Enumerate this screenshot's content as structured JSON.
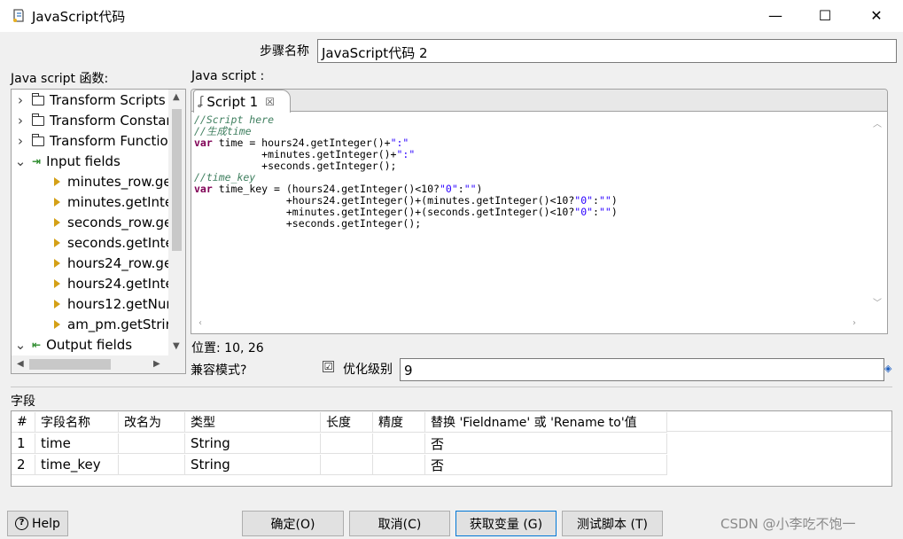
{
  "window": {
    "title": "JavaScript代码",
    "min_glyph": "—",
    "max_glyph": "☐",
    "close_glyph": "✕"
  },
  "step_name": {
    "label": "步骤名称",
    "value": "JavaScript代码 2"
  },
  "functions_panel": {
    "label": "Java script 函数:",
    "items": [
      {
        "label": "Transform Scripts",
        "kind": "folder",
        "expander": "›"
      },
      {
        "label": "Transform Constar",
        "kind": "folder",
        "expander": "›"
      },
      {
        "label": "Transform Functio",
        "kind": "folder",
        "expander": "›"
      },
      {
        "label": "Input fields",
        "kind": "input",
        "expander": "⌄"
      },
      {
        "label": "minutes_row.ge",
        "kind": "field"
      },
      {
        "label": "minutes.getInte",
        "kind": "field"
      },
      {
        "label": "seconds_row.ge",
        "kind": "field"
      },
      {
        "label": "seconds.getInte",
        "kind": "field"
      },
      {
        "label": "hours24_row.ge",
        "kind": "field"
      },
      {
        "label": "hours24.getInte",
        "kind": "field"
      },
      {
        "label": "hours12.getNur",
        "kind": "field"
      },
      {
        "label": "am_pm.getStrir",
        "kind": "field"
      },
      {
        "label": "Output fields",
        "kind": "output",
        "expander": "⌄"
      }
    ]
  },
  "script_panel": {
    "label": "Java script :",
    "tab_label": "Script 1",
    "code_lines": [
      [
        {
          "t": "//Script here",
          "c": "cm"
        }
      ],
      [
        {
          "t": "//生成time",
          "c": "cm"
        }
      ],
      [
        {
          "t": "var",
          "c": "kw"
        },
        {
          "t": " time = hours24.getInteger()+",
          "c": ""
        },
        {
          "t": "\":\"",
          "c": "st"
        }
      ],
      [
        {
          "t": "           +minutes.getInteger()+",
          "c": ""
        },
        {
          "t": "\":\"",
          "c": "st"
        }
      ],
      [
        {
          "t": "           +seconds.getInteger();",
          "c": ""
        }
      ],
      [
        {
          "t": "//time_key",
          "c": "cm"
        }
      ],
      [
        {
          "t": "var",
          "c": "kw"
        },
        {
          "t": " time_key = (hours24.getInteger()<10?",
          "c": ""
        },
        {
          "t": "\"0\"",
          "c": "st"
        },
        {
          "t": ":",
          "c": ""
        },
        {
          "t": "\"\"",
          "c": "st"
        },
        {
          "t": ")",
          "c": ""
        }
      ],
      [
        {
          "t": "               +hours24.getInteger()+(minutes.getInteger()<10?",
          "c": ""
        },
        {
          "t": "\"0\"",
          "c": "st"
        },
        {
          "t": ":",
          "c": ""
        },
        {
          "t": "\"\"",
          "c": "st"
        },
        {
          "t": ")",
          "c": ""
        }
      ],
      [
        {
          "t": "               +minutes.getInteger()+(seconds.getInteger()<10?",
          "c": ""
        },
        {
          "t": "\"0\"",
          "c": "st"
        },
        {
          "t": ":",
          "c": ""
        },
        {
          "t": "\"\"",
          "c": "st"
        },
        {
          "t": ")",
          "c": ""
        }
      ],
      [
        {
          "t": "               +seconds.getInteger();",
          "c": ""
        }
      ]
    ],
    "position_text": "位置: 10, 26"
  },
  "compat": {
    "label": "兼容模式?",
    "opt_label": "优化级别",
    "opt_value": "9",
    "opt_checked": "☑"
  },
  "fields": {
    "label": "字段",
    "columns": [
      "#",
      "字段名称",
      "改名为",
      "类型",
      "长度",
      "精度",
      "替换 'Fieldname' 或 'Rename to'值"
    ],
    "rows": [
      [
        "1",
        "time",
        "",
        "String",
        "",
        "",
        "否"
      ],
      [
        "2",
        "time_key",
        "",
        "String",
        "",
        "",
        "否"
      ]
    ]
  },
  "buttons": {
    "help": "Help",
    "ok": "确定(O)",
    "cancel": "取消(C)",
    "get_vars": "获取变量 (G)",
    "test": "测试脚本 (T)"
  },
  "watermark": "CSDN @小李吃不饱一",
  "colors": {
    "comment": "#3f7f5f",
    "keyword": "#7f0055",
    "string": "#2a00ff",
    "focus_border": "#0078d7"
  }
}
